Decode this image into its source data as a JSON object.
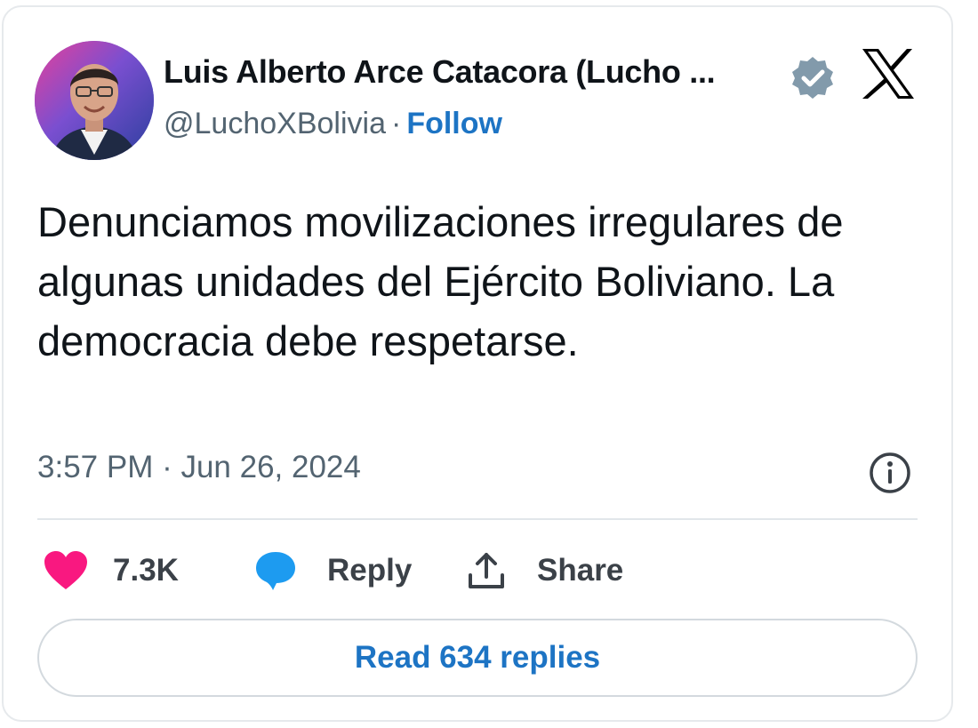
{
  "author": {
    "name": "Luis Alberto Arce Catacora (Lucho ...",
    "handle": "@LuchoXBolivia",
    "separator": "·",
    "follow_label": "Follow",
    "avatar_icon": "profile-photo",
    "verified_icon": "verified-badge-icon"
  },
  "platform_logo": "x-logo",
  "tweet": {
    "text": "Denunciamos movilizaciones irregulares de algunas unidades del Ejército Boliviano. La democracia debe respetarse.",
    "timestamp": "3:57 PM · Jun 26, 2024"
  },
  "actions": {
    "likes_count": "7.3K",
    "reply_label": "Reply",
    "share_label": "Share"
  },
  "read_replies_label": "Read 634 replies",
  "colors": {
    "link_blue": "#1d74c4",
    "like_pink": "#f91880",
    "reply_blue": "#1d9bf0",
    "text_dark": "#0f1419",
    "text_gray": "#536471",
    "verified_gray": "#829aab"
  }
}
